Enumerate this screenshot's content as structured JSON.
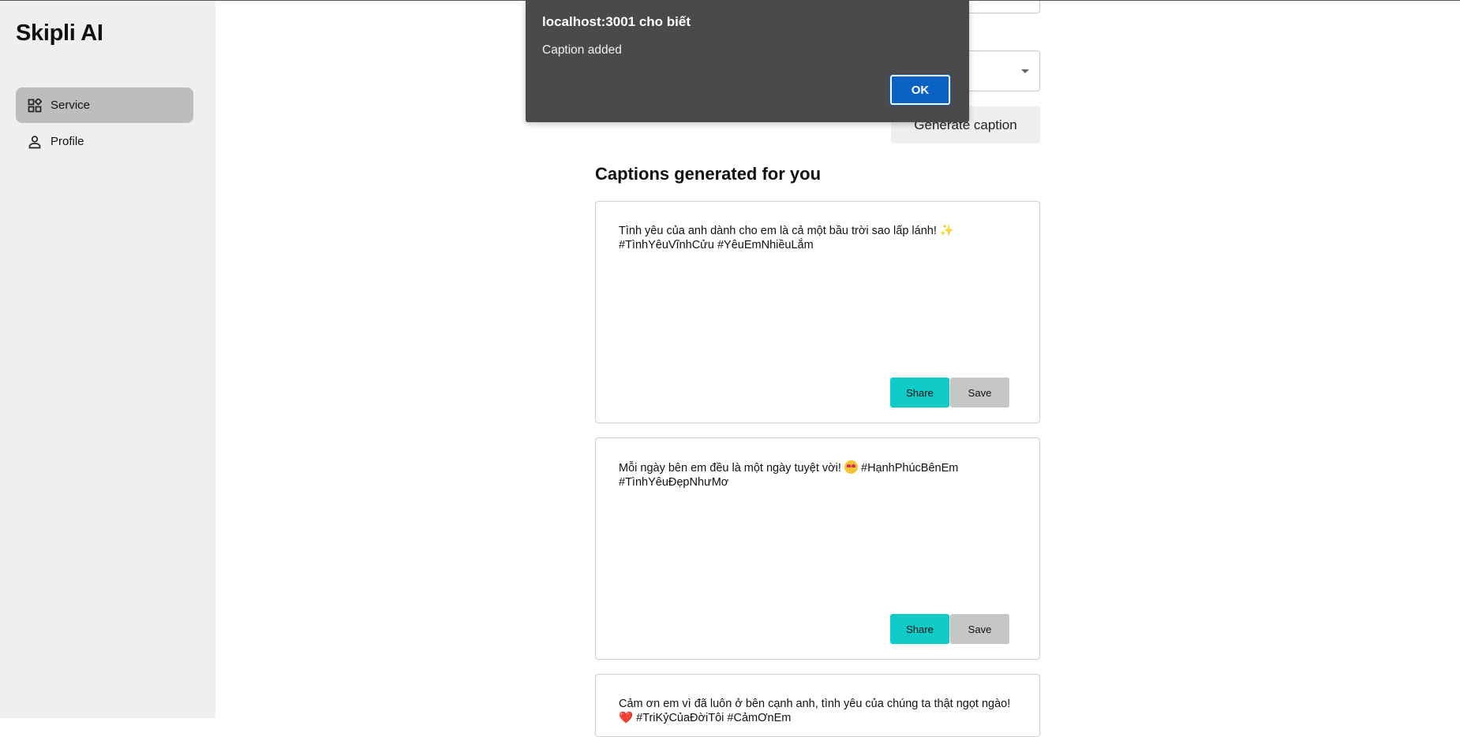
{
  "sidebar": {
    "brand": "Skipli AI",
    "items": [
      {
        "label": "Service",
        "icon": "grid-icon",
        "active": true
      },
      {
        "label": "Profile",
        "icon": "user-icon",
        "active": false
      }
    ]
  },
  "main": {
    "generate_button": "Generate caption",
    "section_title": "Captions generated for you",
    "captions": [
      {
        "text_before": "Tình yêu của anh dành cho em là cả một bầu trời sao lấp lánh!",
        "emoji": "✨",
        "text_after": "#TìnhYêuVĩnhCửu #YêuEmNhiềuLắm",
        "share_label": "Share",
        "save_label": "Save"
      },
      {
        "text_before": "Mỗi ngày bên em đều là một ngày tuyệt vời!",
        "emoji": "🥰",
        "text_after": "#HạnhPhúcBênEm #TìnhYêuĐẹpNhưMơ",
        "share_label": "Share",
        "save_label": "Save"
      },
      {
        "text_before": "Cảm ơn em vì đã luôn ở bên cạnh anh, tình yêu của chúng ta thật ngọt ngào!",
        "emoji": "❤️",
        "text_after": "#TriKỷCủaĐờiTôi #CảmƠnEm"
      }
    ]
  },
  "alert": {
    "origin": "localhost:3001 cho biết",
    "message": "Caption added",
    "ok_label": "OK"
  },
  "colors": {
    "share": "#0fcac6",
    "save": "#c6c6c6",
    "ok": "#0a63c4",
    "sidebar_bg": "#efefef",
    "alert_bg": "#4a4a4a"
  }
}
